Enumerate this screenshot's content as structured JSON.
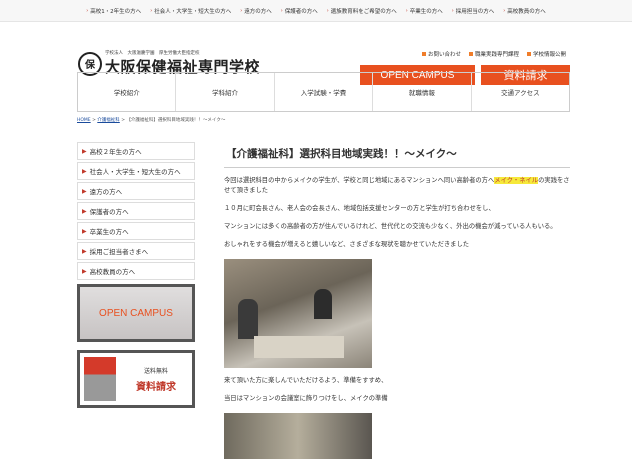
{
  "topbar": {
    "links": [
      "高校1・2年生の方へ",
      "社会人・大学生・短大生の方へ",
      "遠方の方へ",
      "保護者の方へ",
      "遺族教育料をご希望の方へ",
      "卒業生の方へ",
      "採用担当の方へ",
      "高校教員の方へ"
    ]
  },
  "header": {
    "logo_emblem": "保",
    "logo_sub": "学校法人　大阪滋慶学園　厚生労働大臣指定校",
    "logo_main": "大阪保健福祉専門学校",
    "links": [
      "お問い合わせ",
      "職業実践専門課程",
      "学校情報公開"
    ],
    "open_campus_button": "OPEN CAMPUS",
    "request_button": "資料請求"
  },
  "nav": {
    "items": [
      "学校紹介",
      "学科紹介",
      "入学試験・学費",
      "就職情報",
      "交通アクセス"
    ]
  },
  "breadcrumb": {
    "home": "HOME",
    "sep1": " > ",
    "section": "介護福祉科",
    "sep2": " > ",
    "current": "【介護福祉科】選択科目地域実践！！～メイク～"
  },
  "sidebar": {
    "items": [
      "高校２年生の方へ",
      "社会人・大学生・短大生の方へ",
      "遠方の方へ",
      "保護者の方へ",
      "卒業生の方へ",
      "採用ご担当者さまへ",
      "高校教員の方へ"
    ],
    "banner_open_campus": "OPEN CAMPUS",
    "banner_free": "送料無料",
    "banner_request": "資料請求"
  },
  "article": {
    "title": "【介護福祉科】選択科目地域実践！！～メイク～",
    "p1_before": "今回は選択科目の中からメイクの学生が、学校と同じ地域にあるマンションへ同い高齢者の方へ",
    "p1_highlight": "メイク・ネイル",
    "p1_after": "の実践をさせて頂きました",
    "p2": "１０月に町会長さん、老人会の会長さん、地域包括支援センターの方と学生が打ち合わせをし、",
    "p3": "マンションには多くの高齢者の方が住んでいるけれど、世代代との交流も少なく、外出の機会が減っている人もいる。",
    "p4": "おしゃれをする機会が増えると嬉しいなど、さまざまな現状を聴かせていただきました",
    "p5": "来て頂いた方に楽しんでいただけるよう、準備をすすめ、",
    "p6": "当日はマンションの会議室に飾りつけをし、メイクの準備"
  },
  "colors": {
    "accent": "#e8501f",
    "arrow": "#c0392b",
    "highlight": "#f6e93a"
  }
}
